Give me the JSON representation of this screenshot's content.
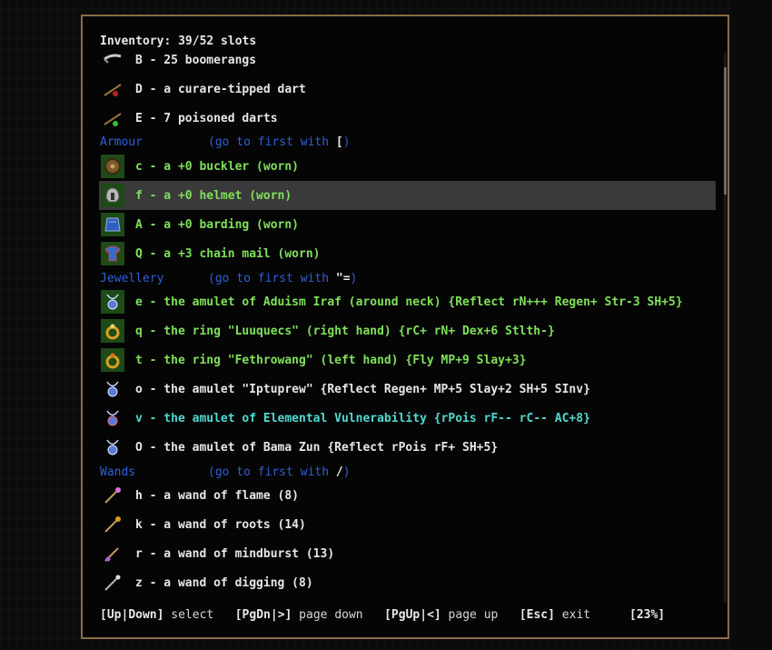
{
  "inventory": {
    "title": "Inventory: 39/52 slots",
    "footer": {
      "k_updown_open": "[",
      "k_up": "Up",
      "sep1": "|",
      "k_down": "Down",
      "k_close1": "]",
      "t_select": " select   ",
      "k_pgdn": "[PgDn|>]",
      "t_pagedown": " page down   ",
      "k_pgup": "[PgUp|<]",
      "t_pageup": " page up   ",
      "k_esc": "[Esc]",
      "t_exit": " exit"
    },
    "percent": "[23%]",
    "scroll_fraction": 0.23,
    "headers": {
      "armour": {
        "label": "Armour",
        "goto": "(go to first with ",
        "sym": "[",
        "end": ")"
      },
      "jewellery": {
        "label": "Jewellery",
        "goto": "(go to first with ",
        "sym": "\"=",
        "end": ")"
      },
      "wands": {
        "label": "Wands",
        "goto": "(go to first with ",
        "sym": "/",
        "end": ")"
      }
    },
    "items": [
      {
        "text": "B - 25 boomerangs",
        "icon": "boomerang-icon"
      },
      {
        "text": "D - a curare-tipped dart",
        "icon": "dart-icon"
      },
      {
        "text": "E - 7 poisoned darts",
        "icon": "dart-icon"
      },
      {
        "text": "c - a +0 buckler (worn)",
        "icon": "buckler-icon"
      },
      {
        "text": "f - a +0 helmet (worn)",
        "icon": "helmet-icon"
      },
      {
        "text": "A - a +0 barding (worn)",
        "icon": "barding-icon"
      },
      {
        "text": "Q - a +3 chain mail (worn)",
        "icon": "chain-mail-icon"
      },
      {
        "text": "e - the amulet of Aduism Iraf (around neck) {Reflect rN+++ Regen+ Str-3 SH+5}",
        "icon": "amulet-icon"
      },
      {
        "text": "q - the ring \"Luuquecs\" (right hand) {rC+ rN+ Dex+6 Stlth-}",
        "icon": "ring-icon"
      },
      {
        "text": "t - the ring \"Fethrowang\" (left hand) {Fly MP+9 Slay+3}",
        "icon": "ring-icon"
      },
      {
        "text": "o - the amulet \"Iptuprew\" {Reflect Regen+ MP+5 Slay+2 SH+5 SInv}",
        "icon": "amulet-icon"
      },
      {
        "text": "v - the amulet of Elemental Vulnerability {rPois rF-- rC-- AC+8}",
        "icon": "amulet-icon"
      },
      {
        "text": "O - the amulet of Bama Zun {Reflect rPois rF+ SH+5}",
        "icon": "amulet-icon"
      },
      {
        "text": "h - a wand of flame (8)",
        "icon": "wand-icon"
      },
      {
        "text": "k - a wand of roots (14)",
        "icon": "wand-icon"
      },
      {
        "text": "r - a wand of mindburst (13)",
        "icon": "wand-icon"
      },
      {
        "text": "z - a wand of digging (8)",
        "icon": "wand-icon"
      }
    ],
    "colors": {
      "equipped": "#7fe05a",
      "normal": "#e6e6e6",
      "special": "#4fd9d0",
      "header": "#2f5fd8",
      "border": "#8a6d46",
      "selected_row": "#3a3a3a"
    }
  }
}
